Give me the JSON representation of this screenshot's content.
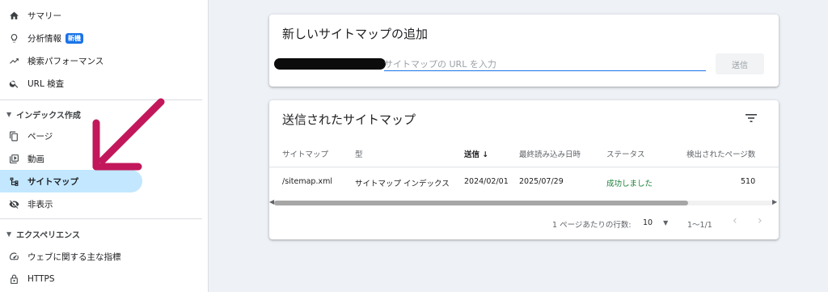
{
  "sidebar": {
    "items": [
      {
        "label": "サマリー",
        "icon": "home-icon"
      },
      {
        "label": "分析情報",
        "icon": "lightbulb-icon",
        "badge": "新機"
      },
      {
        "label": "検索パフォーマンス",
        "icon": "trending-up-icon"
      },
      {
        "label": "URL 検査",
        "icon": "search-icon"
      }
    ],
    "section_index": "インデックス作成",
    "index_items": [
      {
        "label": "ページ",
        "icon": "pages-icon"
      },
      {
        "label": "動画",
        "icon": "video-icon"
      },
      {
        "label": "サイトマップ",
        "icon": "sitemap-icon"
      },
      {
        "label": "非表示",
        "icon": "visibility-off-icon"
      }
    ],
    "section_experience": "エクスペリエンス",
    "experience_items": [
      {
        "label": "ウェブに関する主な指標",
        "icon": "gauge-icon"
      },
      {
        "label": "HTTPS",
        "icon": "lock-icon"
      }
    ]
  },
  "add_card": {
    "title": "新しいサイトマップの追加",
    "input_placeholder": "サイトマップの URL を入力",
    "submit_label": "送信"
  },
  "submitted_card": {
    "title": "送信されたサイトマップ",
    "columns": [
      "サイトマップ",
      "型",
      "送信 ↓",
      "最終読み込み日時",
      "ステータス",
      "検出されたページ数"
    ],
    "rows": [
      [
        "/sitemap.xml",
        "サイトマップ インデックス",
        "2024/02/01",
        "2025/07/29",
        "成功しました",
        "510"
      ]
    ],
    "rows_per_page_label": "1 ページあたりの行数:",
    "rows_per_page_value": "10",
    "range": "1〜1/1"
  },
  "colors": {
    "accent": "#1a73e8",
    "success": "#188038",
    "arrow": "#c2185b",
    "active_bg": "#c2e7ff"
  }
}
